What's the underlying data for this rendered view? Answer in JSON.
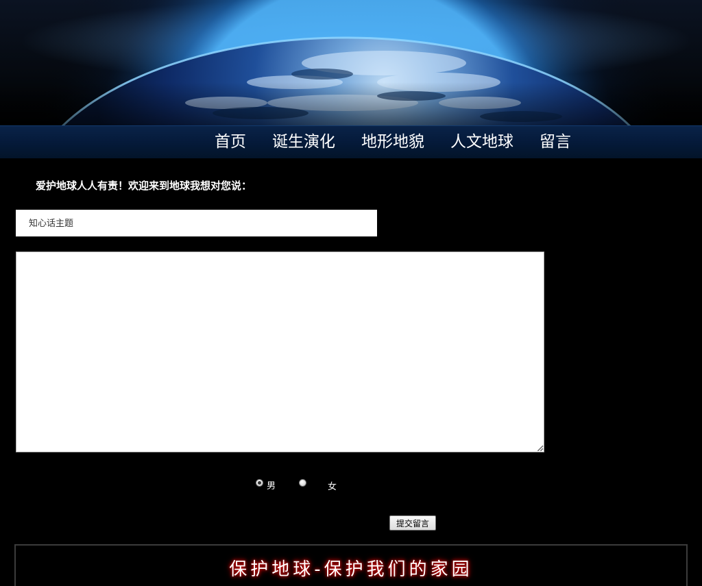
{
  "nav": {
    "items": [
      {
        "label": "首页"
      },
      {
        "label": "诞生演化"
      },
      {
        "label": "地形地貌"
      },
      {
        "label": "人文地球"
      },
      {
        "label": "留言"
      }
    ]
  },
  "intro": {
    "text": "爱护地球人人有责！欢迎来到地球我想对您说："
  },
  "form": {
    "subject_placeholder": "知心话主题",
    "subject_value": "",
    "message_value": "",
    "gender_options": [
      {
        "label": "男",
        "checked": true
      },
      {
        "label": "女",
        "checked": false
      }
    ],
    "submit_label": "提交留言"
  },
  "footer": {
    "text": "保护地球-保护我们的家园"
  },
  "colors": {
    "background": "#000000",
    "nav_bar": "#051a3a",
    "footer_glow": "#d40000"
  }
}
